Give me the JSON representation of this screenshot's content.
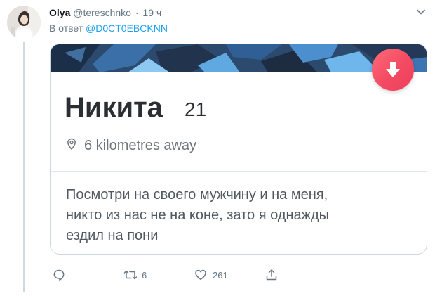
{
  "tweet": {
    "author_name": "Olya",
    "author_handle": "@tereschnko",
    "separator": "·",
    "timestamp": "19 ч",
    "reply_prefix": "В ответ",
    "reply_to": "@D0CT0EBCKNN",
    "menu_icon": "chevron-down-icon"
  },
  "card": {
    "profile_name": "Никита",
    "profile_age": "21",
    "location_icon": "location-pin-icon",
    "distance": "6 kilometres away",
    "action_icon": "arrow-down-icon",
    "bio_lines": [
      "Посмотри на своего мужчину и на меня,",
      "никто из нас не на коне, зато я однажды",
      "ездил на пони"
    ]
  },
  "actions": {
    "reply_icon": "reply-icon",
    "retweet_icon": "retweet-icon",
    "retweet_count": "6",
    "like_icon": "heart-icon",
    "like_count": "261",
    "share_icon": "share-icon"
  },
  "colors": {
    "accent": "#1da1f2",
    "muted": "#657786",
    "tinder_gradient_start": "#ff6b77",
    "tinder_gradient_end": "#ee3f5a"
  }
}
